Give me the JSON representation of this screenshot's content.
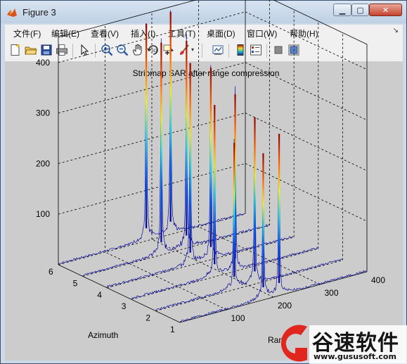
{
  "window": {
    "title": "Figure 3"
  },
  "menu": [
    "文件(F)",
    "编辑(E)",
    "查看(V)",
    "插入(I)",
    "工具(T)",
    "桌面(D)",
    "窗口(W)",
    "帮助(H)"
  ],
  "toolbar": [
    "new-figure",
    "open-file",
    "save",
    "print",
    "pointer",
    "zoom-in",
    "zoom-out",
    "pan",
    "rotate-3d",
    "data-cursor",
    "brush",
    "link-plot",
    "colorbar",
    "legend",
    "hide-plot-tools",
    "show-plot-tools"
  ],
  "plot": {
    "title": "Stripmap SAR after range compression",
    "xlabel": "Azimuth",
    "ylabel": "Ran",
    "z_ticks": [
      "100",
      "200",
      "300",
      "400"
    ],
    "azimuth_ticks": [
      "1",
      "2",
      "3",
      "4",
      "5",
      "6"
    ],
    "range_ticks": [
      "100",
      "200",
      "300",
      "400"
    ]
  },
  "chart_data": {
    "type": "mesh3d",
    "title": "Stripmap SAR after range compression",
    "xlabel": "Azimuth",
    "ylabel": "Ran",
    "x": [
      1,
      2,
      3,
      4,
      5,
      6
    ],
    "xlim": [
      1,
      6
    ],
    "ylim": [
      0,
      400
    ],
    "zlim": [
      0,
      450
    ],
    "series": [
      {
        "azimuth": 1,
        "peaks": [
          {
            "range": 178,
            "amp": 290
          },
          {
            "range": 212,
            "amp": 320
          }
        ]
      },
      {
        "azimuth": 2,
        "peaks": [
          {
            "range": 168,
            "amp": 290
          },
          {
            "range": 212,
            "amp": 330
          }
        ]
      },
      {
        "azimuth": 3,
        "peaks": [
          {
            "range": 178,
            "amp": 340
          },
          {
            "range": 222,
            "amp": 350
          }
        ]
      },
      {
        "azimuth": 4,
        "peaks": [
          {
            "range": 178,
            "amp": 400
          },
          {
            "range": 222,
            "amp": 380
          }
        ]
      },
      {
        "azimuth": 5,
        "peaks": [
          {
            "range": 168,
            "amp": 420
          },
          {
            "range": 222,
            "amp": 410
          }
        ]
      },
      {
        "azimuth": 6,
        "peaks": [
          {
            "range": 188,
            "amp": 430
          },
          {
            "range": 240,
            "amp": 440
          }
        ]
      }
    ]
  },
  "watermark": {
    "cn": "谷速软件",
    "url": "www.gususoft.com"
  }
}
